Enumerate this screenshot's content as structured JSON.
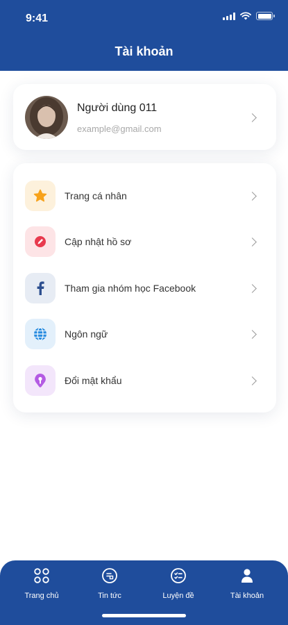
{
  "status_bar": {
    "time": "9:41"
  },
  "header": {
    "title": "Tài khoản"
  },
  "profile": {
    "name": "Người dùng 011",
    "email": "example@gmail.com"
  },
  "menu": {
    "items": [
      {
        "label": "Trang cá nhân",
        "icon": "star-icon",
        "icon_color": "#f7a21b",
        "bg_color": "#fdf1dc"
      },
      {
        "label": "Cập nhật hồ sơ",
        "icon": "pen-icon",
        "icon_color": "#e83a4e",
        "bg_color": "#fde4e6"
      },
      {
        "label": "Tham gia nhóm học Facebook",
        "icon": "facebook-icon",
        "icon_color": "#2d4f8f",
        "bg_color": "#e7ecf4"
      },
      {
        "label": "Ngôn ngữ",
        "icon": "globe-icon",
        "icon_color": "#2b8de0",
        "bg_color": "#e3f0fb"
      },
      {
        "label": "Đổi mật khẩu",
        "icon": "key-icon",
        "icon_color": "#b45be3",
        "bg_color": "#f3e6fb"
      }
    ]
  },
  "tabbar": {
    "tabs": [
      {
        "label": "Trang chủ",
        "icon": "grid-icon"
      },
      {
        "label": "Tin tức",
        "icon": "news-icon"
      },
      {
        "label": "Luyện đề",
        "icon": "checklist-icon"
      },
      {
        "label": "Tài khoản",
        "icon": "user-icon",
        "active": true
      }
    ]
  },
  "colors": {
    "primary": "#1f4d9c"
  }
}
